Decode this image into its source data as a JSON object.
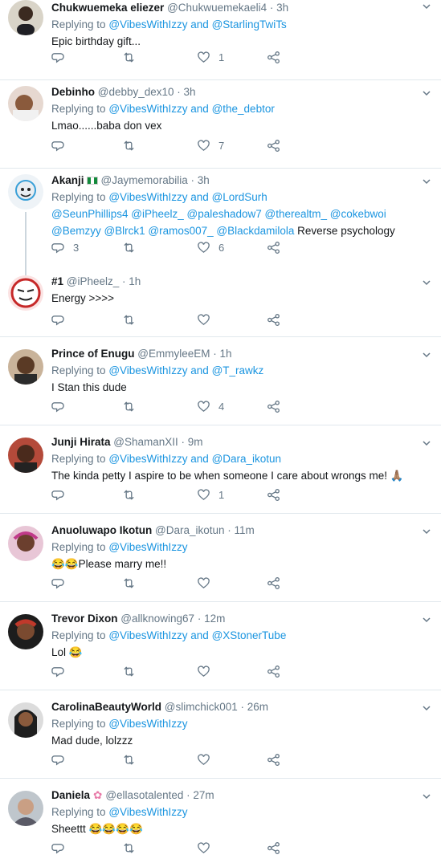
{
  "colors": {
    "link": "#1b95e0",
    "muted": "#657786",
    "divider": "#e1e8ed"
  },
  "tweets": [
    {
      "name": "Chukwuemeka eliezer",
      "handle": "@Chukwuemekaeli4",
      "time": "3h",
      "reply_prefix": "Replying to",
      "reply_to": "@VibesWithIzzy and @StarlingTwiTs",
      "text": "Epic birthday gift...",
      "replies": "",
      "retweets": "",
      "likes": "1"
    },
    {
      "name": "Debinho",
      "handle": "@debby_dex10",
      "time": "3h",
      "reply_prefix": "Replying to",
      "reply_to": "@VibesWithIzzy and @the_debtor",
      "text": "Lmao......baba don vex",
      "replies": "",
      "retweets": "",
      "likes": "7"
    },
    {
      "name": "Akanji",
      "handle": "@Jaymemorabilia",
      "time": "3h",
      "reply_prefix": "Replying to",
      "reply_to": "@VibesWithIzzy and @LordSurh",
      "text_links_1": "@SeunPhillips4 @iPheelz_ @paleshadow7 @therealtm_ @cokebwoi",
      "text_links_2": "@Bemzyy @Blrck1 @ramos007_ @Blackdamilola",
      "text_tail": " Reverse psychology",
      "replies": "3",
      "retweets": "",
      "likes": "6"
    },
    {
      "name": "#1",
      "handle": "@iPheelz_",
      "time": "1h",
      "text": "Energy >>>>",
      "replies": "",
      "retweets": "",
      "likes": ""
    },
    {
      "name": "Prince of Enugu",
      "handle": "@EmmyleeEM",
      "time": "1h",
      "reply_prefix": "Replying to",
      "reply_to": "@VibesWithIzzy and @T_rawkz",
      "text": "I Stan this dude",
      "replies": "",
      "retweets": "",
      "likes": "4"
    },
    {
      "name": "Junji Hirata",
      "handle": "@ShamanXII",
      "time": "9m",
      "reply_prefix": "Replying to",
      "reply_to": "@VibesWithIzzy and @Dara_ikotun",
      "text": "The kinda petty I aspire to be when someone I care about wrongs me! 🙏🏽",
      "replies": "",
      "retweets": "",
      "likes": "1"
    },
    {
      "name": "Anuoluwapo Ikotun",
      "handle": "@Dara_ikotun",
      "time": "11m",
      "reply_prefix": "Replying to",
      "reply_to": "@VibesWithIzzy",
      "text": "😂😂Please marry me!!",
      "replies": "",
      "retweets": "",
      "likes": ""
    },
    {
      "name": "Trevor Dixon",
      "handle": "@allknowing67",
      "time": "12m",
      "reply_prefix": "Replying to",
      "reply_to": "@VibesWithIzzy and @XStonerTube",
      "text": "Lol 😂",
      "replies": "",
      "retweets": "",
      "likes": ""
    },
    {
      "name": "CarolinaBeautyWorld",
      "handle": "@slimchick001",
      "time": "26m",
      "reply_prefix": "Replying to",
      "reply_to": "@VibesWithIzzy",
      "text": "Mad dude, lolzzz",
      "replies": "",
      "retweets": "",
      "likes": ""
    },
    {
      "name": "Daniela",
      "handle": "@ellasotalented",
      "time": "27m",
      "reply_prefix": "Replying to",
      "reply_to": "@VibesWithIzzy",
      "text": "Sheettt 😂😂😂😂",
      "replies": "",
      "retweets": "",
      "likes": ""
    }
  ]
}
